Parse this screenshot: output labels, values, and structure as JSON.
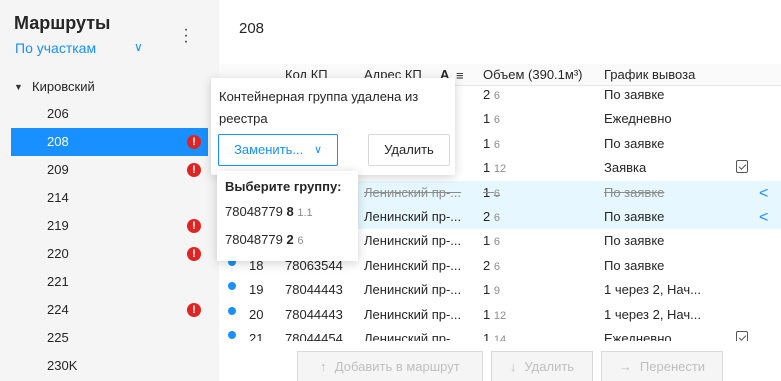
{
  "sidebar": {
    "title": "Маршруты",
    "filter": "По участкам",
    "group": "Кировский",
    "items": [
      {
        "label": "206",
        "alert": false,
        "active": false
      },
      {
        "label": "208",
        "alert": true,
        "active": true
      },
      {
        "label": "209",
        "alert": true,
        "active": false
      },
      {
        "label": "214",
        "alert": false,
        "active": false
      },
      {
        "label": "219",
        "alert": true,
        "active": false
      },
      {
        "label": "220",
        "alert": true,
        "active": false
      },
      {
        "label": "221",
        "alert": false,
        "active": false
      },
      {
        "label": "224",
        "alert": true,
        "active": false
      },
      {
        "label": "225",
        "alert": false,
        "active": false
      },
      {
        "label": "230K",
        "alert": false,
        "active": false
      }
    ]
  },
  "route": {
    "title": "208"
  },
  "table": {
    "headers": {
      "code": "Код КП",
      "address": "Адрес КП",
      "volume": "Объем (390.1м³)",
      "schedule": "График вывоза"
    },
    "rows": [
      {
        "num": "",
        "code": "",
        "address": "",
        "vol": "2",
        "vol_sub": "6",
        "schedule": "По заявке",
        "dot": false,
        "hl": false,
        "strike": false,
        "cal": false,
        "back": false
      },
      {
        "num": "",
        "code": "",
        "address": "",
        "vol": "1",
        "vol_sub": "6",
        "schedule": "Ежедневно",
        "dot": false,
        "hl": false,
        "strike": false,
        "cal": false,
        "back": false
      },
      {
        "num": "",
        "code": "",
        "address": "",
        "vol": "1",
        "vol_sub": "6",
        "schedule": "По заявке",
        "dot": false,
        "hl": false,
        "strike": false,
        "cal": false,
        "back": false
      },
      {
        "num": "",
        "code": "",
        "address": "",
        "vol": "1",
        "vol_sub": "12",
        "schedule": "Заявка",
        "dot": false,
        "hl": false,
        "strike": false,
        "cal": true,
        "back": false
      },
      {
        "num": "",
        "code": "",
        "address": "Ленинский пр-...",
        "vol": "1",
        "vol_sub": "6",
        "schedule": "По заявке",
        "dot": false,
        "hl": true,
        "strike": true,
        "cal": false,
        "back": true
      },
      {
        "num": "",
        "code": "",
        "address": "Ленинский пр-...",
        "vol": "2",
        "vol_sub": "6",
        "schedule": "По заявке",
        "dot": false,
        "hl": true,
        "strike": false,
        "cal": false,
        "back": true
      },
      {
        "num": "",
        "code": "",
        "address": "Ленинский пр-...",
        "vol": "1",
        "vol_sub": "6",
        "schedule": "По заявке",
        "dot": false,
        "hl": false,
        "strike": false,
        "cal": false,
        "back": false
      },
      {
        "num": "18",
        "code": "78063544",
        "address": "Ленинский пр-...",
        "vol": "2",
        "vol_sub": "6",
        "schedule": "По заявке",
        "dot": true,
        "hl": false,
        "strike": false,
        "cal": false,
        "back": false
      },
      {
        "num": "19",
        "code": "78044443",
        "address": "Ленинский пр-...",
        "vol": "1",
        "vol_sub": "9",
        "schedule": "1 через 2, Нач...",
        "dot": true,
        "hl": false,
        "strike": false,
        "cal": false,
        "back": false
      },
      {
        "num": "20",
        "code": "78044443",
        "address": "Ленинский пр-...",
        "vol": "1",
        "vol_sub": "12",
        "schedule": "1 через 2, Нач...",
        "dot": true,
        "hl": false,
        "strike": false,
        "cal": false,
        "back": false
      },
      {
        "num": "21",
        "code": "78044454",
        "address": "Ленинский пр-...",
        "vol": "1",
        "vol_sub": "14",
        "schedule": "Ежедневно",
        "dot": true,
        "hl": false,
        "strike": false,
        "cal": true,
        "back": false
      }
    ]
  },
  "popover": {
    "message": "Контейнерная группа удалена из реестра",
    "replace": "Заменить...",
    "delete": "Удалить"
  },
  "dropdown": {
    "title": "Выберите группу:",
    "options": [
      {
        "code": "78048779",
        "count": "8",
        "sub": "1.1"
      },
      {
        "code": "78048779",
        "count": "2",
        "sub": "6"
      }
    ]
  },
  "bottom": {
    "add": "Добавить в маршрут",
    "remove": "Удалить",
    "move": "Перенести"
  }
}
